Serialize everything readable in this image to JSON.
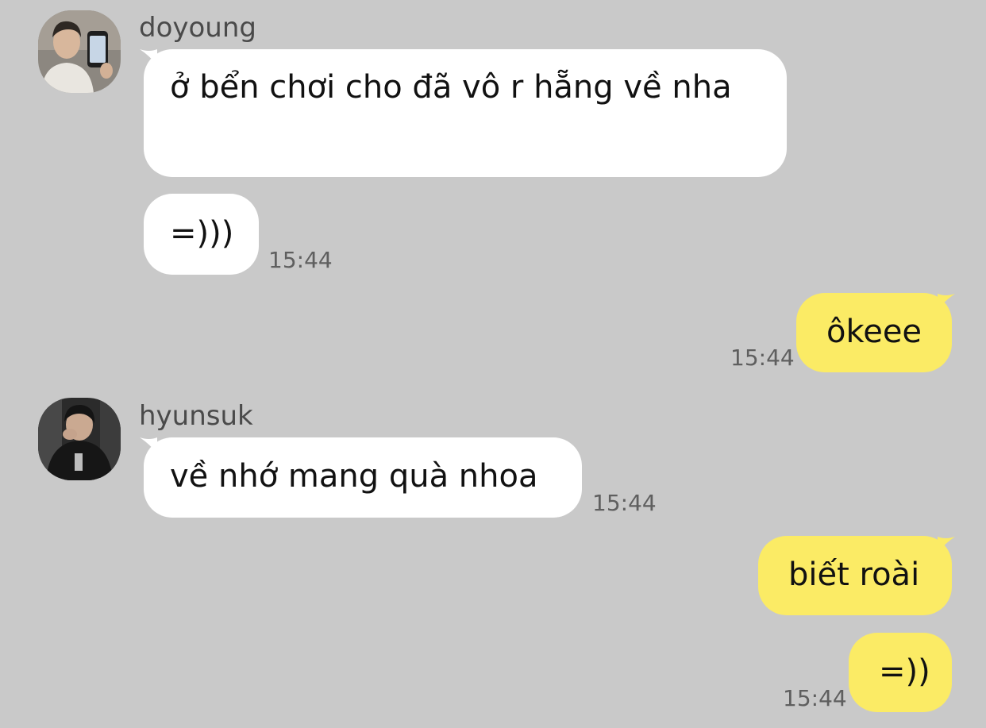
{
  "colors": {
    "background": "#c9c9c9",
    "incoming_bubble": "#ffffff",
    "outgoing_bubble": "#fbeb65",
    "timestamp": "#5f5f5f",
    "sender_name": "#4a4a4a"
  },
  "messages": {
    "doyoung": {
      "name": "doyoung",
      "avatar_icon": "user-photo-avatar",
      "msg1": "ở bển chơi cho đã vô r hẵng về nha",
      "msg2": "=)))",
      "time": "15:44"
    },
    "me1": {
      "msg1": "ôkeee",
      "time": "15:44"
    },
    "hyunsuk": {
      "name": "hyunsuk",
      "avatar_icon": "user-photo-avatar",
      "msg1": "về nhớ mang quà nhoa",
      "time": "15:44"
    },
    "me2": {
      "msg1": "biết roài",
      "msg2": "=))",
      "time": "15:44"
    }
  }
}
